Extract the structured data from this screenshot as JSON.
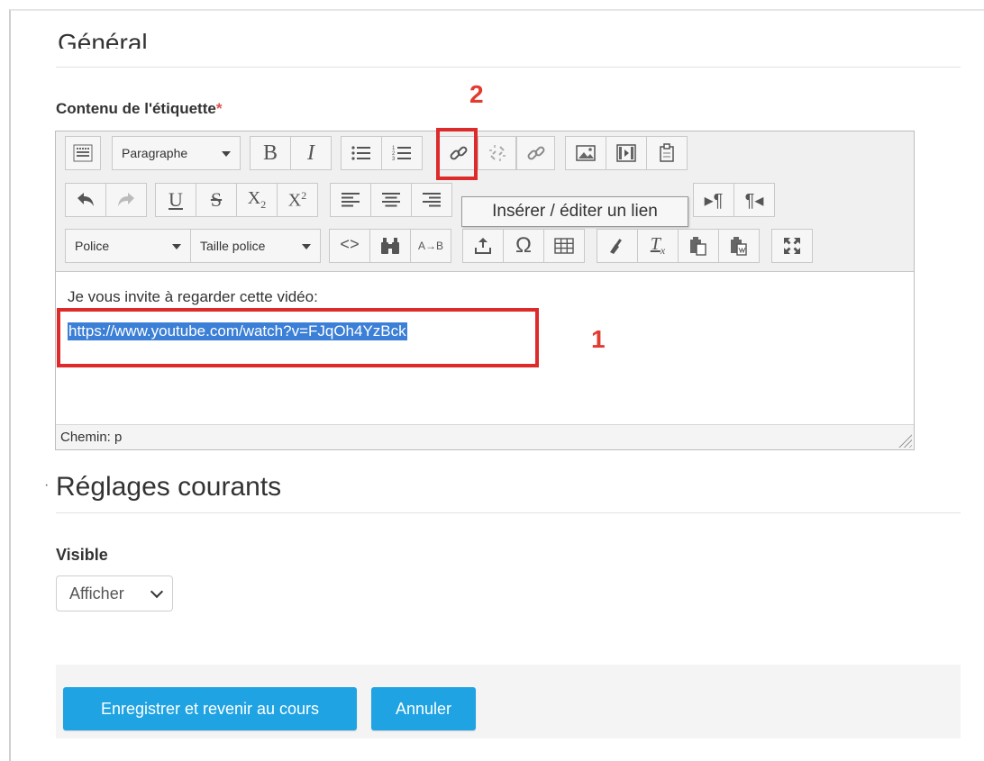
{
  "form": {
    "section_general": "Général",
    "content_label": "Contenu de l'étiquette",
    "required_mark": "*",
    "section_settings": "Réglages courants",
    "settings_marker": "·",
    "visible_label": "Visible",
    "visible_value": "Afficher",
    "save_button": "Enregistrer et revenir au cours",
    "cancel_button": "Annuler"
  },
  "editor": {
    "format_select": "Paragraphe",
    "font_select": "Police",
    "size_select": "Taille police",
    "tooltip": "Insérer / éditer un lien",
    "text_line": "Je vous invite à regarder cette vidéo:",
    "link_text": "https://www.youtube.com/watch?v=FJqOh4YzBck",
    "status_path": "Chemin: p"
  },
  "annotations": {
    "label1": "1",
    "label2": "2",
    "color": "#dd2a2a"
  },
  "toolbar_icons": {
    "row1": [
      "toolbar-toggle-icon",
      "bold-icon",
      "italic-icon",
      "bullet-list-icon",
      "numbered-list-icon",
      "link-icon",
      "unlink-icon",
      "anchor-link-icon",
      "image-icon",
      "media-icon",
      "paste-word-icon"
    ],
    "row2": [
      "undo-icon",
      "redo-icon",
      "underline-icon",
      "strikethrough-icon",
      "subscript-icon",
      "superscript-icon",
      "align-left-icon",
      "align-center-icon",
      "align-right-icon",
      "ltr-icon",
      "rtl-icon"
    ],
    "row3": [
      "html-source-icon",
      "find-icon",
      "replace-icon",
      "insert-line-icon",
      "special-char-icon",
      "table-icon",
      "clean-format-icon",
      "clear-format-icon",
      "paste-text-icon",
      "paste-word-icon",
      "fullscreen-icon"
    ]
  }
}
